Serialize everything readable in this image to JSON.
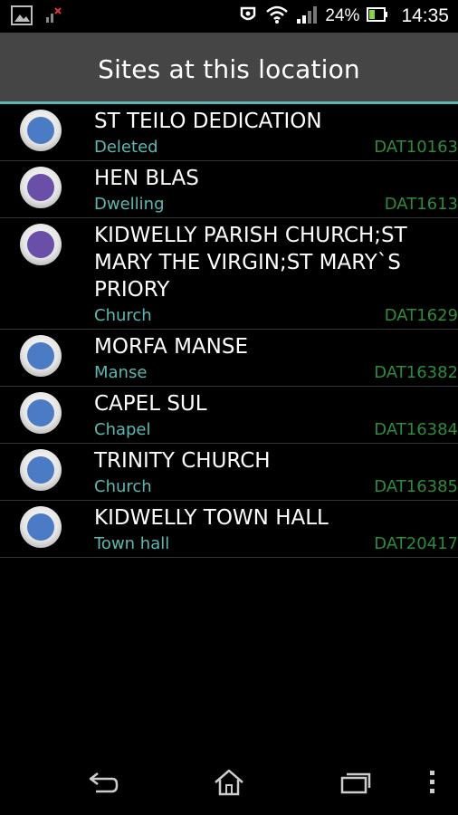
{
  "status_bar": {
    "battery_text": "24%",
    "clock": "14:35",
    "icons": [
      "gallery-icon",
      "signal-blocked-icon",
      "usb-icon",
      "wifi-icon",
      "cell-signal-icon",
      "battery-icon"
    ]
  },
  "action_bar": {
    "title": "Sites at this location"
  },
  "sites": [
    {
      "name": "ST TEILO DEDICATION",
      "type": "Deleted",
      "code": "DAT10163",
      "dot_color": "#4a7bc4"
    },
    {
      "name": "HEN BLAS",
      "type": "Dwelling",
      "code": "DAT1613",
      "dot_color": "#6a4fa8"
    },
    {
      "name": "KIDWELLY PARISH CHURCH;ST MARY THE VIRGIN;ST MARY`S PRIORY",
      "type": "Church",
      "code": "DAT1629",
      "dot_color": "#6a4fa8"
    },
    {
      "name": "MORFA MANSE",
      "type": "Manse",
      "code": "DAT16382",
      "dot_color": "#4a7bc4"
    },
    {
      "name": "CAPEL SUL",
      "type": "Chapel",
      "code": "DAT16384",
      "dot_color": "#4a7bc4"
    },
    {
      "name": "TRINITY CHURCH",
      "type": "Church",
      "code": "DAT16385",
      "dot_color": "#4a7bc4"
    },
    {
      "name": "KIDWELLY TOWN HALL",
      "type": "Town hall",
      "code": "DAT20417",
      "dot_color": "#4a7bc4"
    }
  ],
  "nav_bar": {
    "icons": [
      "back-icon",
      "home-icon",
      "recent-apps-icon",
      "overflow-menu-icon"
    ]
  }
}
